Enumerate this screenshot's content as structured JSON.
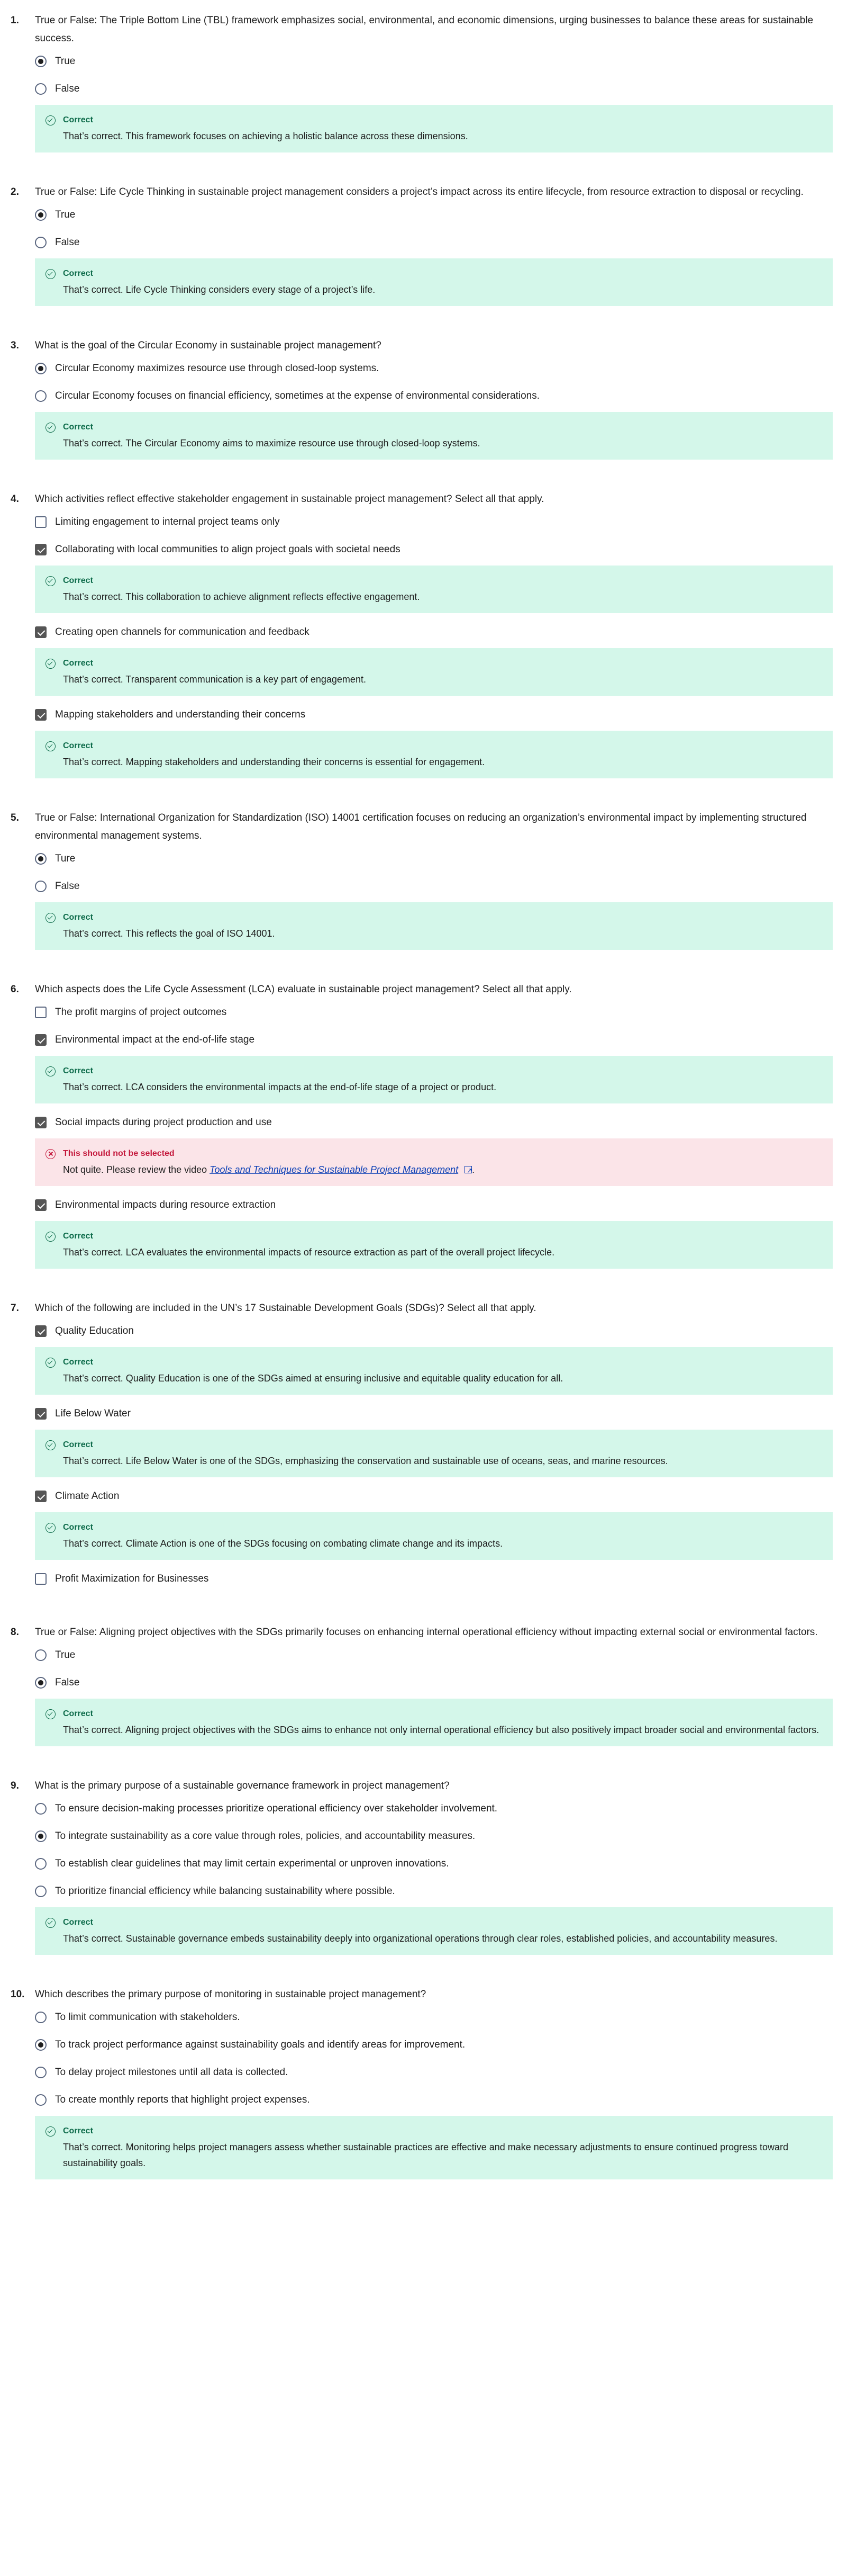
{
  "questions": [
    {
      "num": "1.",
      "text": "True or False: The Triple Bottom Line (TBL) framework emphasizes social, environmental, and economic dimensions, urging businesses to balance these areas for sustainable success.",
      "type": "radio",
      "options": [
        {
          "label": "True",
          "selected": true,
          "feedback": null
        },
        {
          "label": "False",
          "selected": false,
          "feedback": null
        }
      ],
      "feedback": {
        "status": "Correct",
        "message": "That’s correct. This framework focuses on achieving a holistic balance across these dimensions."
      }
    },
    {
      "num": "2.",
      "text": "True or False: Life Cycle Thinking in sustainable project management considers a project’s impact across its entire lifecycle, from resource extraction to disposal or recycling.",
      "type": "radio",
      "options": [
        {
          "label": "True",
          "selected": true
        },
        {
          "label": "False",
          "selected": false
        }
      ],
      "feedback": {
        "status": "Correct",
        "message": "That’s correct. Life Cycle Thinking considers every stage of a project’s life."
      }
    },
    {
      "num": "3.",
      "text": "What is the goal of the Circular Economy in sustainable project management?",
      "type": "radio",
      "options": [
        {
          "label": "Circular Economy maximizes resource use through closed-loop systems.",
          "selected": true
        },
        {
          "label": "Circular Economy focuses on financial efficiency, sometimes at the expense of environmental considerations.",
          "selected": false
        }
      ],
      "feedback": {
        "status": "Correct",
        "message": "That’s correct. The Circular Economy aims to maximize resource use through closed-loop systems."
      }
    },
    {
      "num": "4.",
      "text": "Which activities reflect effective stakeholder engagement in sustainable project management? Select all that apply.",
      "type": "checkbox",
      "options": [
        {
          "label": "Limiting engagement to internal project teams only",
          "selected": false
        },
        {
          "label": "Collaborating with local communities to align project goals with societal needs",
          "selected": true,
          "feedback": {
            "status": "Correct",
            "message": "That’s correct. This collaboration to achieve alignment reflects effective engagement."
          }
        },
        {
          "label": "Creating open channels for communication and feedback",
          "selected": true,
          "feedback": {
            "status": "Correct",
            "message": "That’s correct. Transparent communication is a key part of engagement."
          }
        },
        {
          "label": "Mapping stakeholders and understanding their concerns",
          "selected": true,
          "feedback": {
            "status": "Correct",
            "message": "That’s correct. Mapping stakeholders and understanding their concerns is essential for engagement."
          }
        }
      ]
    },
    {
      "num": "5.",
      "text": "True or False: International Organization for Standardization (ISO) 14001 certification focuses on reducing an organization’s environmental impact by implementing structured environmental management systems.",
      "type": "radio",
      "options": [
        {
          "label": "Ture",
          "selected": true
        },
        {
          "label": "False",
          "selected": false
        }
      ],
      "feedback": {
        "status": "Correct",
        "message": "That’s correct. This reflects the goal of ISO 14001."
      }
    },
    {
      "num": "6.",
      "text": "Which aspects does the Life Cycle Assessment (LCA) evaluate in sustainable project management? Select all that apply.",
      "type": "checkbox",
      "options": [
        {
          "label": "The profit margins of project outcomes",
          "selected": false
        },
        {
          "label": "Environmental impact at the end-of-life stage",
          "selected": true,
          "feedback": {
            "status": "Correct",
            "message": "That’s correct. LCA considers the environmental impacts at the end-of-life stage of a project or product."
          }
        },
        {
          "label": "Social impacts during project production and use",
          "selected": true,
          "feedback": {
            "status": "This should not be selected",
            "bad": true,
            "message": "Not quite. Please review the video ",
            "link": "Tools and Techniques for Sustainable Project Management",
            "suffix": "."
          }
        },
        {
          "label": "Environmental impacts during resource extraction",
          "selected": true,
          "feedback": {
            "status": "Correct",
            "message": "That’s correct. LCA evaluates the environmental impacts of resource extraction as part of the overall project lifecycle."
          }
        }
      ]
    },
    {
      "num": "7.",
      "text": "Which of the following are included in  the UN’s 17 Sustainable Development Goals (SDGs)? Select all that apply.",
      "type": "checkbox",
      "options": [
        {
          "label": "Quality Education",
          "selected": true,
          "feedback": {
            "status": "Correct",
            "message": "That’s correct. Quality Education is one of the SDGs aimed at ensuring inclusive and equitable quality education for all."
          }
        },
        {
          "label": "Life Below Water",
          "selected": true,
          "feedback": {
            "status": "Correct",
            "message": "That’s correct. Life Below Water is one of the SDGs, emphasizing the conservation and sustainable use of oceans, seas, and marine resources."
          }
        },
        {
          "label": "Climate Action",
          "selected": true,
          "feedback": {
            "status": "Correct",
            "message": "That’s correct. Climate Action is one of the SDGs focusing on combating climate change and its impacts."
          }
        },
        {
          "label": "Profit Maximization for Businesses",
          "selected": false
        }
      ]
    },
    {
      "num": "8.",
      "text": "True or False: Aligning project objectives with the SDGs primarily focuses on enhancing internal operational efficiency without impacting external social or environmental factors.",
      "type": "radio",
      "options": [
        {
          "label": "True",
          "selected": false
        },
        {
          "label": "False",
          "selected": true
        }
      ],
      "feedback": {
        "status": "Correct",
        "message": "That’s correct. Aligning project objectives with the SDGs aims to enhance not only internal operational efficiency but also positively impact broader social and environmental factors."
      }
    },
    {
      "num": "9.",
      "text": "What is the primary purpose of a sustainable governance framework in project management?",
      "type": "radio",
      "options": [
        {
          "label": "To ensure decision-making processes prioritize operational efficiency over stakeholder involvement.",
          "selected": false
        },
        {
          "label": "To integrate sustainability as a core value through roles, policies, and accountability measures.",
          "selected": true
        },
        {
          "label": "To establish clear guidelines that may limit certain experimental or unproven innovations.",
          "selected": false
        },
        {
          "label": "To prioritize financial efficiency while balancing sustainability where possible.",
          "selected": false
        }
      ],
      "feedback": {
        "status": "Correct",
        "message": "That’s correct. Sustainable governance embeds sustainability deeply into organizational operations through clear roles, established policies, and accountability measures."
      }
    },
    {
      "num": "10.",
      "text": "Which describes the primary purpose of monitoring in sustainable project management?",
      "type": "radio",
      "options": [
        {
          "label": "To limit communication with stakeholders.",
          "selected": false
        },
        {
          "label": "To track project performance against sustainability goals and identify areas for improvement.",
          "selected": true
        },
        {
          "label": "To delay project milestones until all data is collected.",
          "selected": false
        },
        {
          "label": "To create monthly reports that highlight project expenses.",
          "selected": false
        }
      ],
      "feedback": {
        "status": "Correct",
        "message": "That’s correct. Monitoring helps project managers assess whether sustainable practices are effective and make necessary adjustments to ensure continued progress toward sustainability goals."
      }
    }
  ]
}
